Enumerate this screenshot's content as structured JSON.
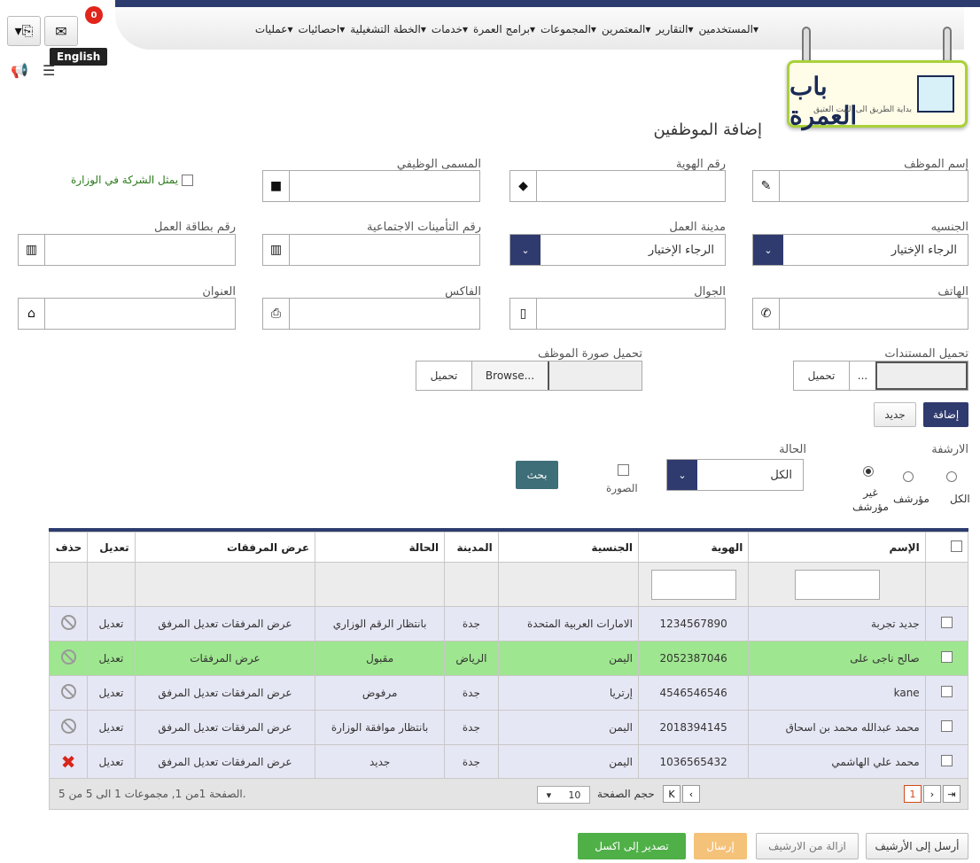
{
  "nav": {
    "menu": [
      "المستخدمين",
      "التقارير",
      "المعتمرين",
      "المجموعات",
      "برامج العمرة",
      "خدمات",
      "الخطة التشغيلية",
      "احصائيات",
      "عمليات"
    ],
    "badge": "0",
    "language": "English"
  },
  "logo": {
    "name": "باب العمرة",
    "tagline": "بداية الطريق الى البيت العتيق"
  },
  "form": {
    "title": "إضافة الموظفين",
    "employee_name": "إسم الموظف",
    "id_number": "رقم الهوية",
    "job_title": "المسمى الوظيفي",
    "represents": "يمثل الشركة في الوزارة",
    "nationality": "الجنسيه",
    "work_city": "مدينة العمل",
    "insurance_number": "رقم التأمينات الاجتماعية",
    "work_card": "رقم بطاقة العمل",
    "select_placeholder": "الرجاء الإختيار",
    "phone": "الهاتف",
    "mobile": "الجوال",
    "fax": "الفاكس",
    "address": "العنوان",
    "upload_docs": "تحميل المستندات",
    "upload_photo": "تحميل صورة الموظف",
    "browse": "Browse...",
    "browse_short": "...",
    "upload_btn": "تحميل",
    "add_btn": "إضافة",
    "new_btn": "جديد"
  },
  "search": {
    "archive_label": "الارشفة",
    "opt_all": "الكل",
    "opt_archived": "مؤرشف",
    "opt_not_archived_1": "غير",
    "opt_not_archived_2": "مؤرشف",
    "status_label": "الحالة",
    "status_value": "الكل",
    "image_label": "الصورة",
    "search_btn": "بحث"
  },
  "table": {
    "headers": {
      "name": "الإسم",
      "id": "الهوية",
      "nationality": "الجنسية",
      "city": "المدينة",
      "status": "الحالة",
      "attachments": "عرض المرفقات",
      "edit": "تعديل",
      "delete": "حذف"
    },
    "rows": [
      {
        "name": "جديد تجربة",
        "id": "1234567890",
        "nationality": "الامارات العربية المتحدة",
        "city": "جدة",
        "status": "بانتظار الرقم الوزاري",
        "attachments": "عرض المرفقات تعديل المرفق",
        "edit": "تعديل",
        "del": "ban"
      },
      {
        "name": "صالح ناجى على",
        "id": "2052387046",
        "nationality": "اليمن",
        "city": "الرياض",
        "status": "مقبول",
        "attachments": "عرض المرفقات",
        "edit": "تعديل",
        "del": "ban"
      },
      {
        "name": "kane",
        "id": "4546546546",
        "nationality": "إرتريا",
        "city": "جدة",
        "status": "مرفوض",
        "attachments": "عرض المرفقات تعديل المرفق",
        "edit": "تعديل",
        "del": "ban"
      },
      {
        "name": "محمد عبدالله محمد بن اسحاق",
        "id": "2018394145",
        "nationality": "اليمن",
        "city": "جدة",
        "status": "بانتظار موافقة الوزارة",
        "attachments": "عرض المرفقات تعديل المرفق",
        "edit": "تعديل",
        "del": "ban"
      },
      {
        "name": "محمد علي الهاشمي",
        "id": "1036565432",
        "nationality": "اليمن",
        "city": "جدة",
        "status": "جديد",
        "attachments": "عرض المرفقات تعديل المرفق",
        "edit": "تعديل",
        "del": "x"
      }
    ]
  },
  "pager": {
    "page": "1",
    "page_size_label": "حجم الصفحة",
    "page_size": "10",
    "summary": "الصفحة 1من 1, مجموعات 1 الى 5 من 5."
  },
  "actions": {
    "send_archive": "أرسل إلى الأرشيف",
    "remove_archive": "ازالة من الارشيف",
    "send": "إرسال",
    "export": "تصدير إلى اكسل"
  },
  "colors": {
    "navy": "#2d3c6e",
    "highlight": "#9ee68f",
    "row": "#e6e7f4",
    "green": "#4fb048",
    "orange": "#f5c27a"
  }
}
